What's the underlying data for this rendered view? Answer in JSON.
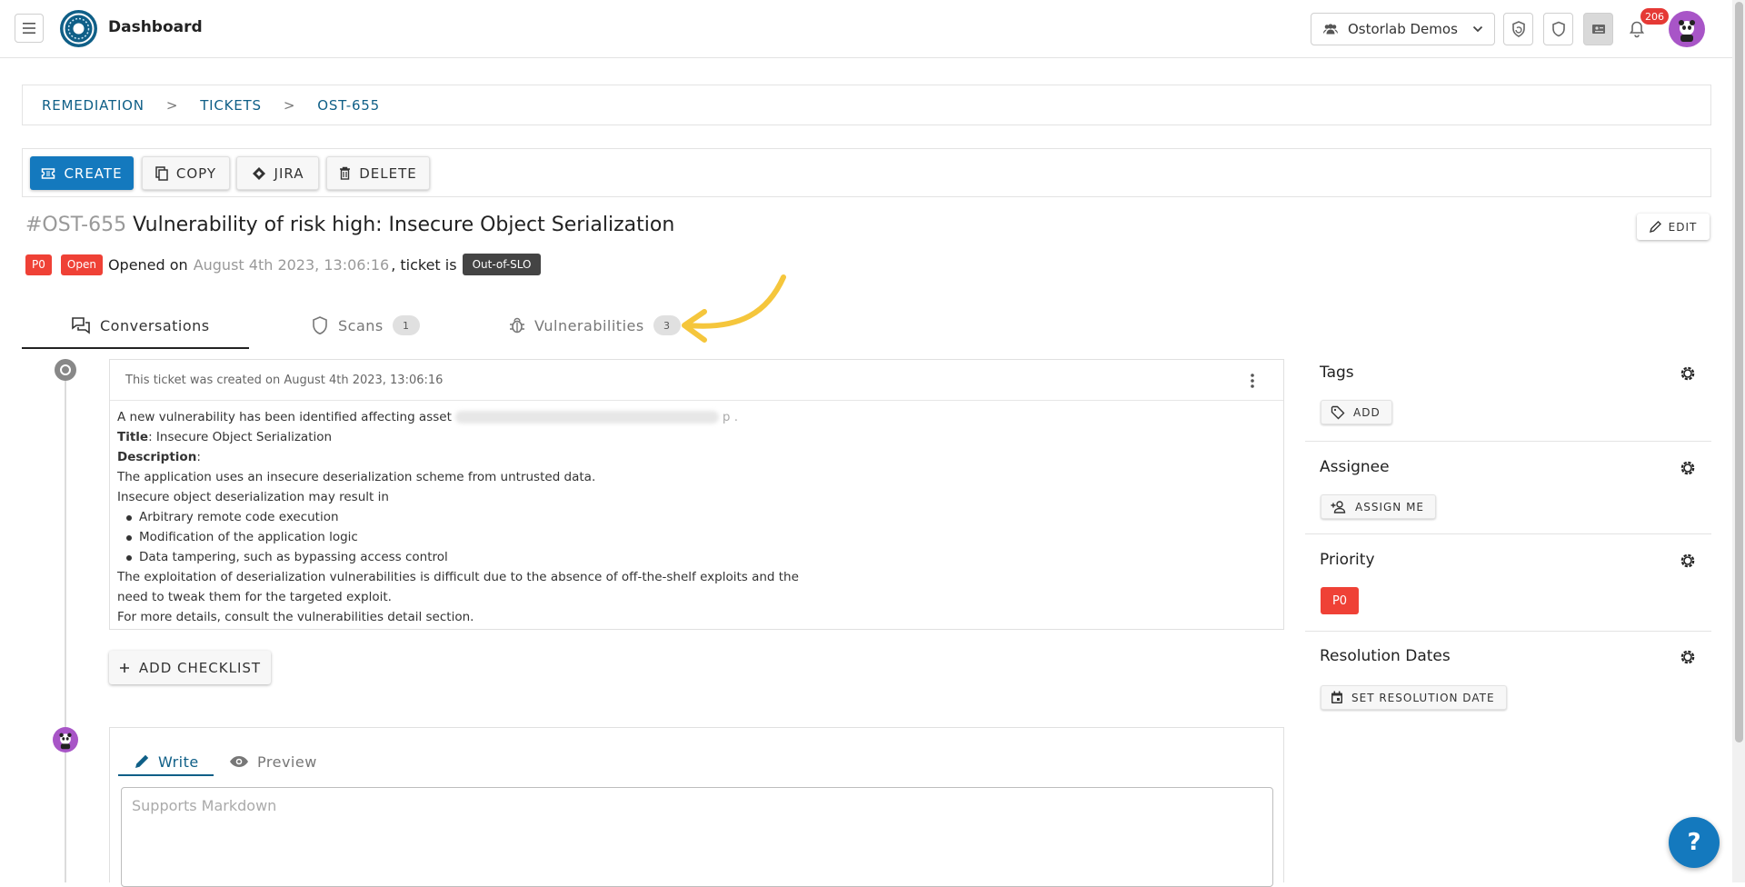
{
  "app": {
    "title": "Dashboard"
  },
  "header": {
    "org_select": "Ostorlab Demos",
    "notification_count": "206",
    "icons": [
      "menu-icon",
      "refresh-icon",
      "shield-icon",
      "ticket-icon",
      "bell-icon",
      "user-avatar"
    ]
  },
  "breadcrumb": {
    "items": [
      "REMEDIATION",
      "TICKETS",
      "OST-655"
    ],
    "separator": ">"
  },
  "actions": {
    "create": "CREATE",
    "copy": "COPY",
    "jira": "JIRA",
    "delete": "DELETE"
  },
  "ticket": {
    "id": "#OST-655",
    "title": "Vulnerability of risk high: Insecure Object Serialization",
    "edit_label": "EDIT",
    "priority": "P0",
    "status": "Open",
    "opened_on_label": "Opened on",
    "opened_date": "August 4th 2023, 13:06:16",
    "ticket_is_label": ", ticket is",
    "slo_status": "Out-of-SLO"
  },
  "tabs": [
    {
      "label": "Conversations",
      "active": true
    },
    {
      "label": "Scans",
      "count": "1"
    },
    {
      "label": "Vulnerabilities",
      "count": "3"
    }
  ],
  "conversation": {
    "created_text": "This ticket was created on August 4th 2023, 13:06:16",
    "intro": "A new vulnerability has been identified affecting asset",
    "intro_end": "p .",
    "title_label": "Title",
    "title_value": ": Insecure Object Serialization",
    "description_label": "Description",
    "description_colon": ":",
    "lines": [
      "The application uses an insecure deserialization scheme from untrusted data.",
      "Insecure object deserialization may result in"
    ],
    "bullets": [
      "Arbitrary remote code execution",
      "Modification of the application logic",
      "Data tampering, such as bypassing access control"
    ],
    "closing": [
      "The exploitation of deserialization vulnerabilities is difficult due to the absence of off-the-shelf exploits and the",
      "need to tweak them for the targeted exploit.",
      "For more details, consult the vulnerabilities detail section."
    ],
    "add_checklist": "ADD CHECKLIST"
  },
  "editor": {
    "write_tab": "Write",
    "preview_tab": "Preview",
    "placeholder": "Supports Markdown"
  },
  "sidebar": {
    "tags": {
      "title": "Tags",
      "button": "ADD"
    },
    "assignee": {
      "title": "Assignee",
      "button": "ASSIGN ME"
    },
    "priority": {
      "title": "Priority",
      "value": "P0"
    },
    "resolution": {
      "title": "Resolution Dates",
      "button": "SET RESOLUTION DATE"
    }
  },
  "help": {
    "label": "?"
  },
  "colors": {
    "primary": "#1479be",
    "brand": "#0f5f87",
    "danger": "#ef4136",
    "annotation_arrow": "#f5c63c"
  }
}
